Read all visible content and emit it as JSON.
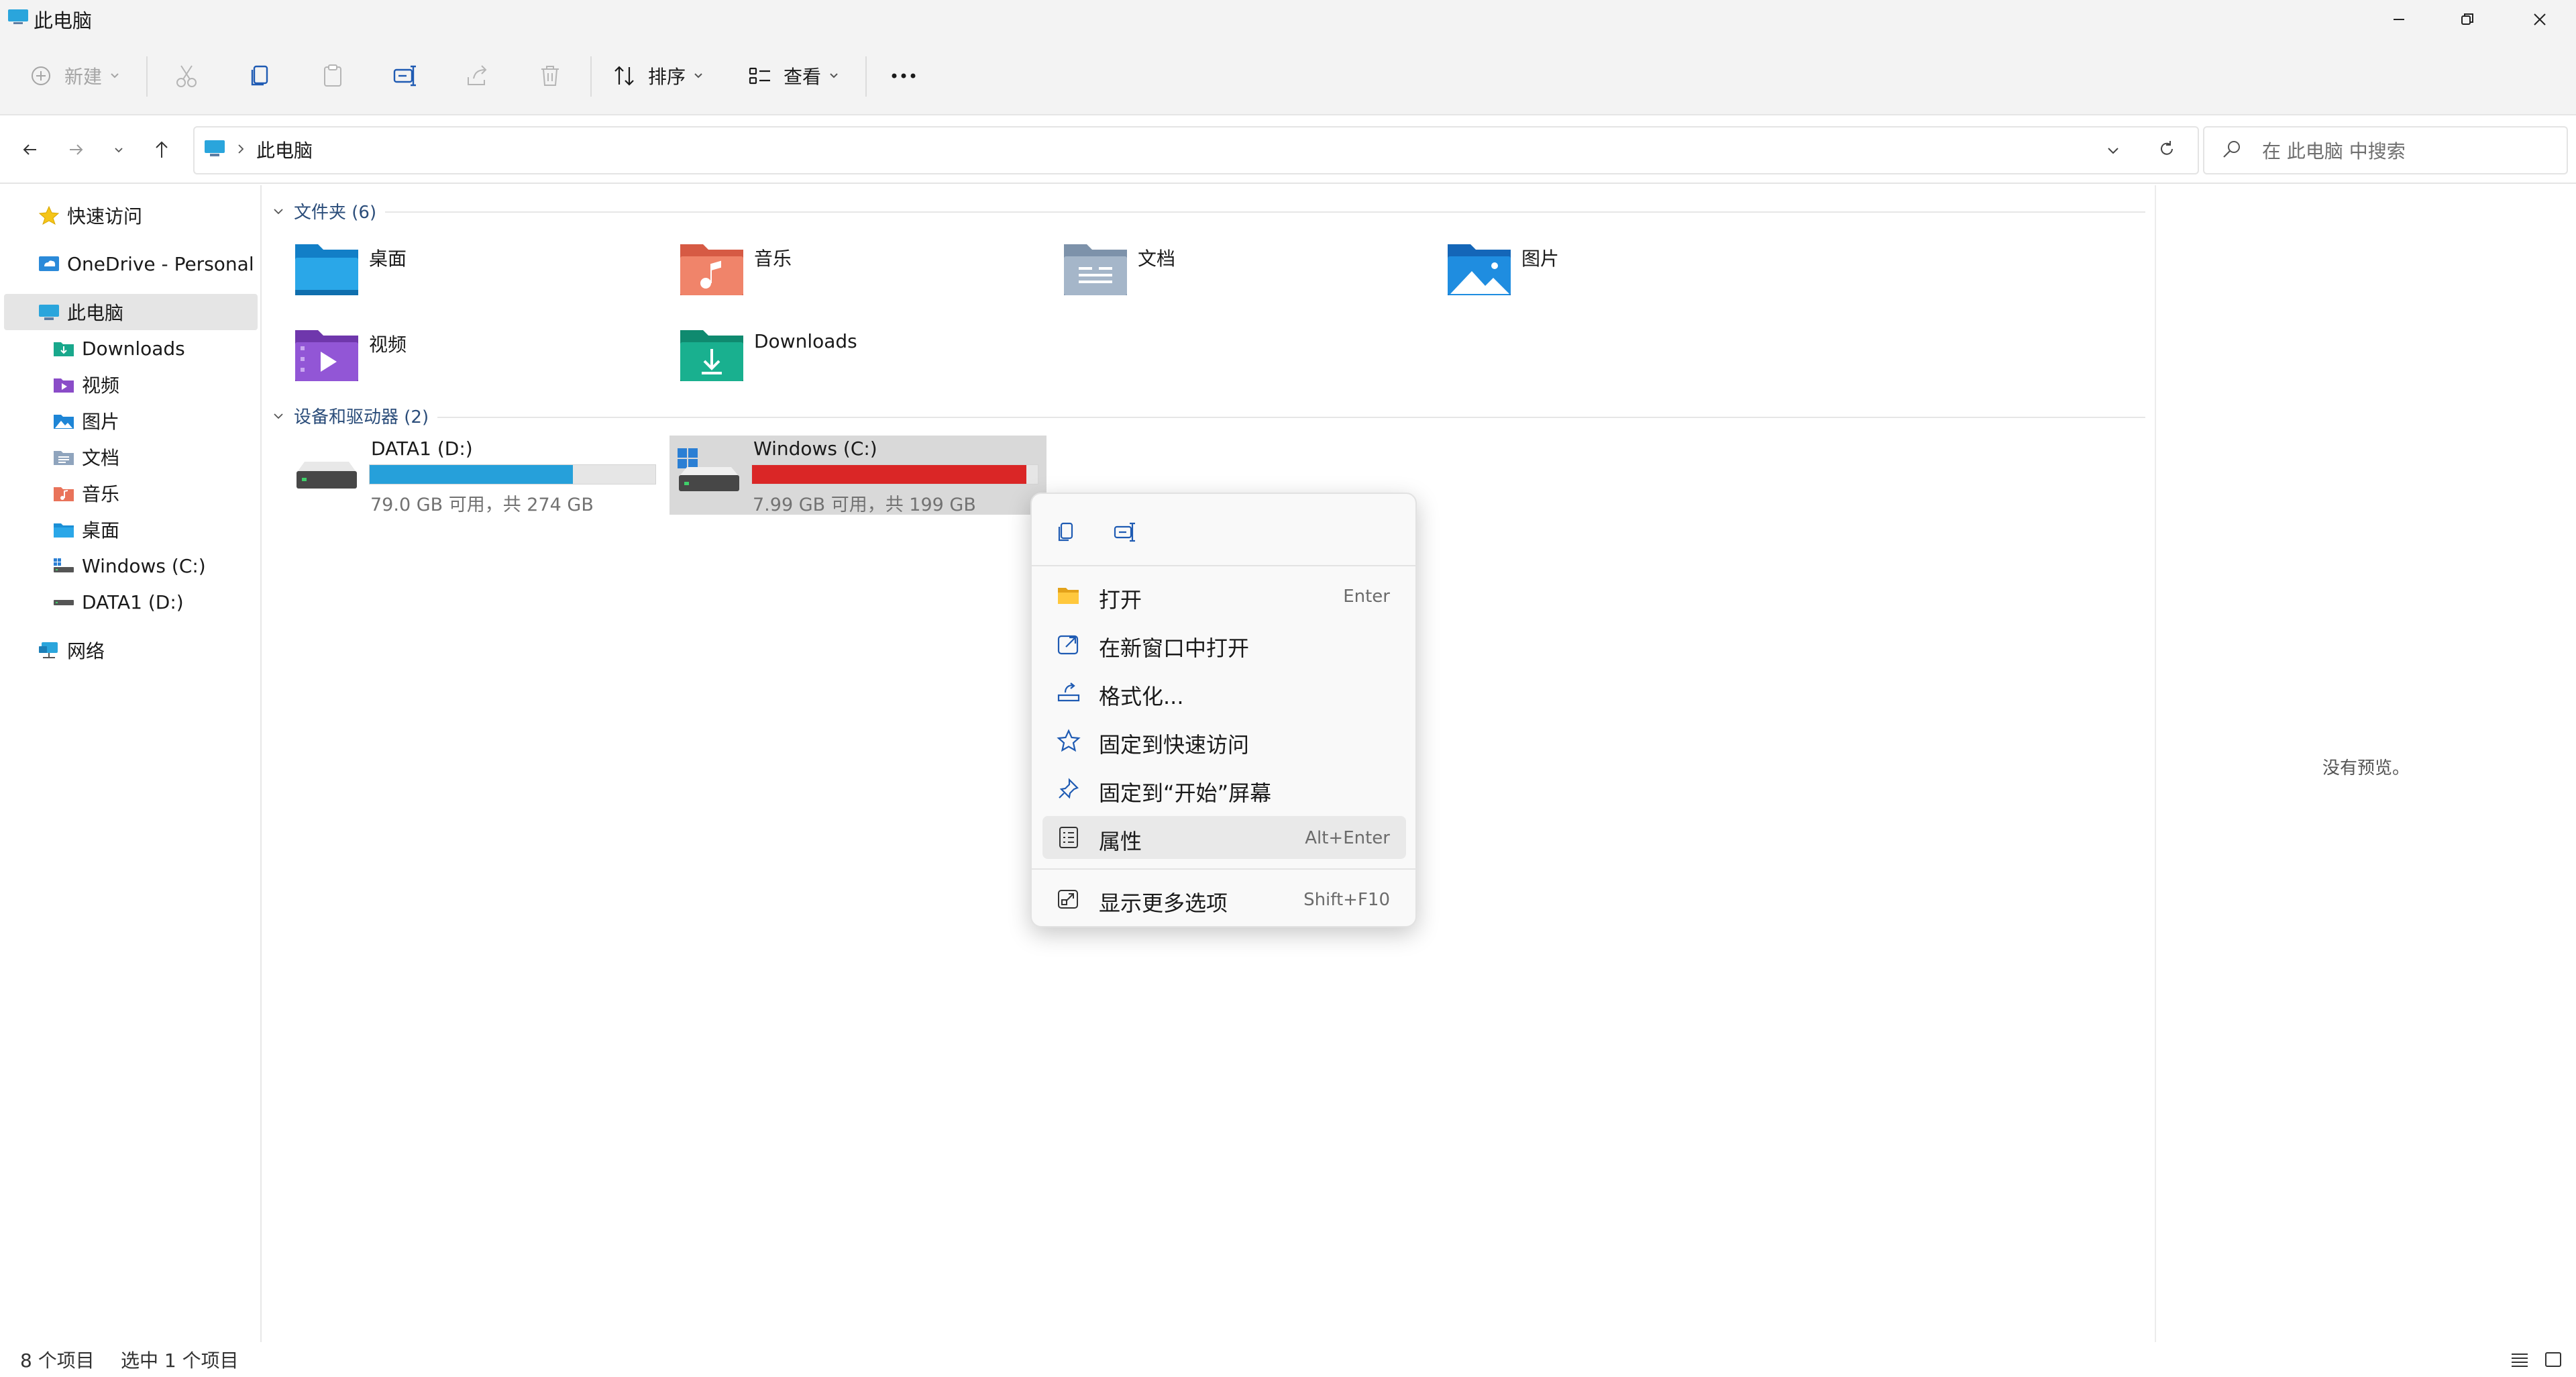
{
  "window": {
    "title": "此电脑",
    "minimize_icon": "minimize-icon",
    "maximize_icon": "restore-icon",
    "close_icon": "close-icon"
  },
  "toolbar": {
    "new_label": "新建",
    "sort_label": "排序",
    "view_label": "查看",
    "icons": [
      "cut-icon",
      "copy-icon",
      "paste-icon",
      "rename-icon",
      "share-icon",
      "delete-icon",
      "more-icon"
    ]
  },
  "address": {
    "path": "此电脑",
    "search_placeholder": "在 此电脑 中搜索"
  },
  "nav": {
    "items": [
      {
        "label": "快速访问",
        "icon": "star-icon"
      },
      {
        "label": "OneDrive - Personal",
        "icon": "cloud-icon"
      },
      {
        "label": "此电脑",
        "icon": "computer-icon",
        "selected": true
      },
      {
        "label": "Downloads",
        "icon": "downloads-folder-icon"
      },
      {
        "label": "视频",
        "icon": "videos-folder-icon"
      },
      {
        "label": "图片",
        "icon": "pictures-folder-icon"
      },
      {
        "label": "文档",
        "icon": "documents-folder-icon"
      },
      {
        "label": "音乐",
        "icon": "music-folder-icon"
      },
      {
        "label": "桌面",
        "icon": "desktop-folder-icon"
      },
      {
        "label": "Windows (C:)",
        "icon": "system-drive-icon"
      },
      {
        "label": "DATA1 (D:)",
        "icon": "drive-icon"
      },
      {
        "label": "网络",
        "icon": "network-icon"
      }
    ]
  },
  "content": {
    "folders_header": "文件夹 (6)",
    "folders": [
      {
        "name": "桌面",
        "icon": "desktop-folder-icon"
      },
      {
        "name": "音乐",
        "icon": "music-folder-icon"
      },
      {
        "name": "文档",
        "icon": "documents-folder-icon"
      },
      {
        "name": "图片",
        "icon": "pictures-folder-icon"
      },
      {
        "name": "视频",
        "icon": "videos-folder-icon"
      },
      {
        "name": "Downloads",
        "icon": "downloads-folder-icon"
      }
    ],
    "drives_header": "设备和驱动器 (2)",
    "drives": [
      {
        "name": "DATA1 (D:)",
        "info": "79.0 GB 可用，共 274 GB",
        "used_fraction": 0.712,
        "bar_color": "#26a0da"
      },
      {
        "name": "Windows (C:)",
        "info": "7.99 GB 可用，共 199 GB",
        "used_fraction": 0.96,
        "bar_color": "#da2626",
        "selected": true
      }
    ],
    "preview_text": "没有预览。"
  },
  "context_menu": {
    "top_icons": [
      "copy-icon",
      "rename-icon"
    ],
    "items": [
      {
        "label": "打开",
        "shortcut": "Enter",
        "icon": "folder-open-icon"
      },
      {
        "label": "在新窗口中打开",
        "shortcut": "",
        "icon": "new-window-icon"
      },
      {
        "label": "格式化...",
        "shortcut": "",
        "icon": "format-drive-icon"
      },
      {
        "label": "固定到快速访问",
        "shortcut": "",
        "icon": "star-icon"
      },
      {
        "label": "固定到“开始”屏幕",
        "shortcut": "",
        "icon": "pin-icon"
      },
      {
        "label": "属性",
        "shortcut": "Alt+Enter",
        "icon": "properties-icon",
        "hover": true
      },
      {
        "label": "显示更多选项",
        "shortcut": "Shift+F10",
        "icon": "more-options-icon"
      }
    ]
  },
  "status": {
    "item_count": "8 个项目",
    "selected_count": "选中 1 个项目",
    "icons": [
      "details-view-icon",
      "tiles-view-icon"
    ]
  },
  "colors": {
    "accent": "#0067c0",
    "selection": "#e5e5e5",
    "drive_d_bar": "#26a0da",
    "drive_c_bar": "#da2626"
  }
}
